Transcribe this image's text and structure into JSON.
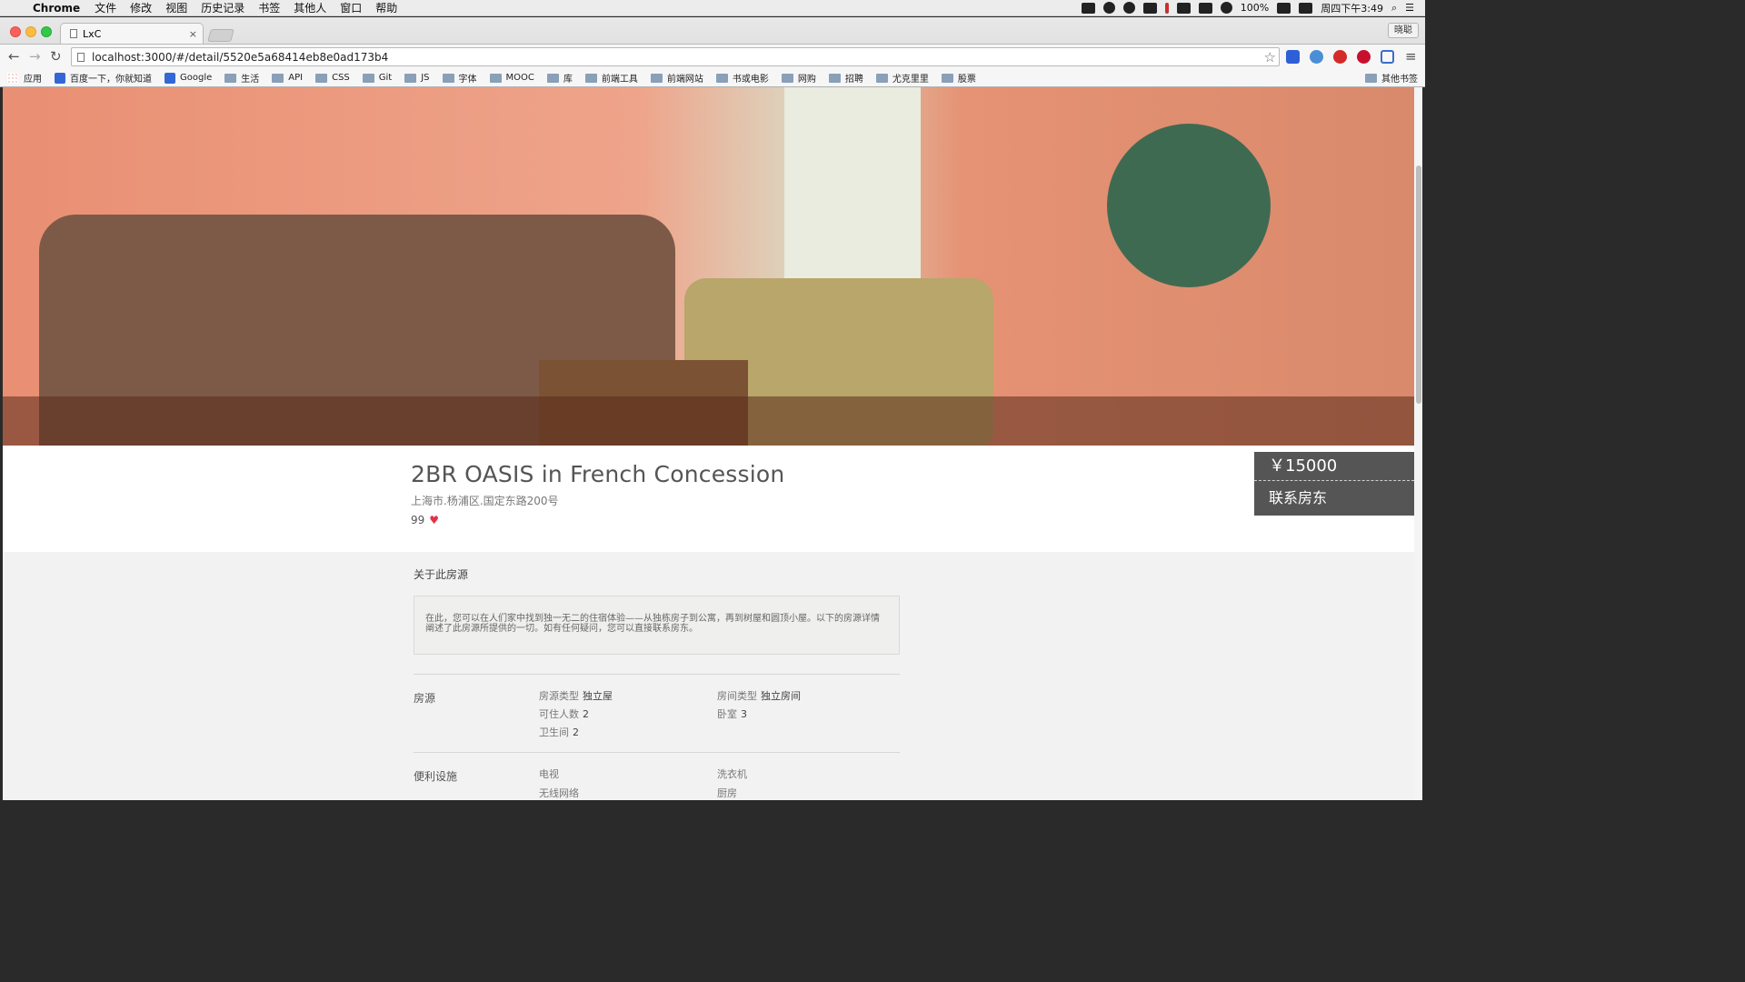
{
  "menubar": {
    "app_name": "Chrome",
    "items": [
      "文件",
      "修改",
      "视图",
      "历史记录",
      "书签",
      "其他人",
      "窗口",
      "帮助"
    ],
    "battery": "100%",
    "clock": "周四下午3:49"
  },
  "browser": {
    "tab_title": "LxC",
    "profile_name": "晓聪",
    "url": "localhost:3000/#/detail/5520e5a68414eb8e0ad173b4",
    "bookmarks": [
      "应用",
      "百度一下，你就知道",
      "Google",
      "生活",
      "API",
      "CSS",
      "Git",
      "JS",
      "字体",
      "MOOC",
      "库",
      "前端工具",
      "前端网站",
      "书或电影",
      "网购",
      "招聘",
      "尤克里里",
      "股票"
    ],
    "other_bookmarks": "其他书签"
  },
  "listing": {
    "title": "2BR OASIS in French Concession",
    "address": "上海市.杨浦区.国定东路200号",
    "likes": "99",
    "price": "￥15000",
    "contact_label": "联系房东"
  },
  "about": {
    "title": "关于此房源",
    "description": "在此，您可以在人们家中找到独一无二的住宿体验——从独栋房子到公寓，再到树屋和圆顶小屋。以下的房源详情阐述了此房源所提供的一切。如有任何疑问，您可以直接联系房东。"
  },
  "property": {
    "label": "房源",
    "type_label": "房源类型",
    "type_value": "独立屋",
    "room_type_label": "房间类型",
    "room_type_value": "独立房间",
    "guests_label": "可住人数",
    "guests_value": "2",
    "bedrooms_label": "卧室",
    "bedrooms_value": "3",
    "bathrooms_label": "卫生间",
    "bathrooms_value": "2"
  },
  "amenities": {
    "label": "便利设施",
    "items": [
      "电视",
      "洗衣机",
      "无线网络",
      "厨房"
    ]
  },
  "colors": {
    "accent_heart": "#e2324a",
    "price_panel": "#555555"
  }
}
